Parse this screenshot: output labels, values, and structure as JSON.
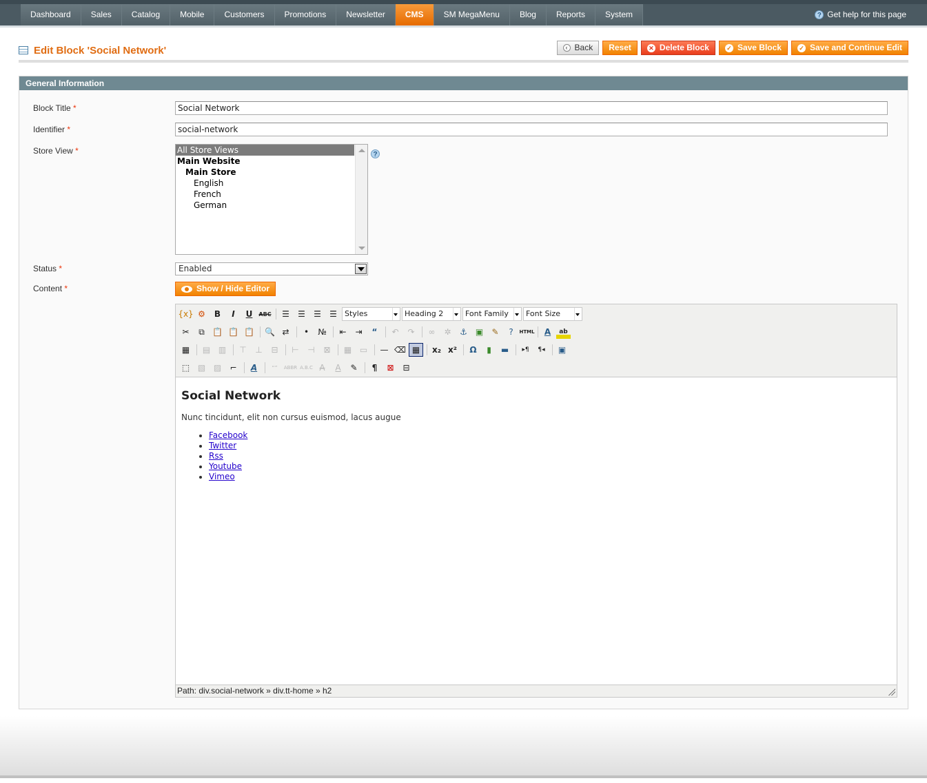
{
  "nav": {
    "items": [
      {
        "label": "Dashboard"
      },
      {
        "label": "Sales"
      },
      {
        "label": "Catalog"
      },
      {
        "label": "Mobile"
      },
      {
        "label": "Customers"
      },
      {
        "label": "Promotions"
      },
      {
        "label": "Newsletter"
      },
      {
        "label": "CMS"
      },
      {
        "label": "SM MegaMenu"
      },
      {
        "label": "Blog"
      },
      {
        "label": "Reports"
      },
      {
        "label": "System"
      }
    ],
    "active": "CMS",
    "help": "Get help for this page"
  },
  "header": {
    "title": "Edit Block 'Social Network'",
    "actions": {
      "back": "Back",
      "reset": "Reset",
      "delete": "Delete Block",
      "save": "Save Block",
      "save_continue": "Save and Continue Edit"
    }
  },
  "form": {
    "section_title": "General Information",
    "block_title": {
      "label": "Block Title",
      "value": "Social Network"
    },
    "identifier": {
      "label": "Identifier",
      "value": "social-network"
    },
    "store_view": {
      "label": "Store View",
      "options": [
        {
          "label": "All Store Views"
        },
        {
          "label": "Main Website"
        },
        {
          "label": "Main Store"
        },
        {
          "label": "English"
        },
        {
          "label": "French"
        },
        {
          "label": "German"
        }
      ]
    },
    "status": {
      "label": "Status",
      "value": "Enabled"
    },
    "content": {
      "label": "Content",
      "toggle_label": "Show / Hide Editor"
    },
    "required_mark": "*"
  },
  "editor": {
    "selects": {
      "styles": "Styles",
      "format": "Heading 2",
      "font_family": "Font Family",
      "font_size": "Font Size"
    },
    "body": {
      "heading": "Social Network",
      "paragraph": "Nunc tincidunt, elit non cursus euismod, lacus augue",
      "links": [
        {
          "label": "Facebook"
        },
        {
          "label": "Twitter"
        },
        {
          "label": "Rss"
        },
        {
          "label": "Youtube"
        },
        {
          "label": "Vimeo"
        }
      ]
    },
    "path": "Path: div.social-network » div.tt-home » h2"
  },
  "colors": {
    "accent": "#eb7a12",
    "section_header": "#6f8992",
    "nav_bg": "#526168"
  }
}
